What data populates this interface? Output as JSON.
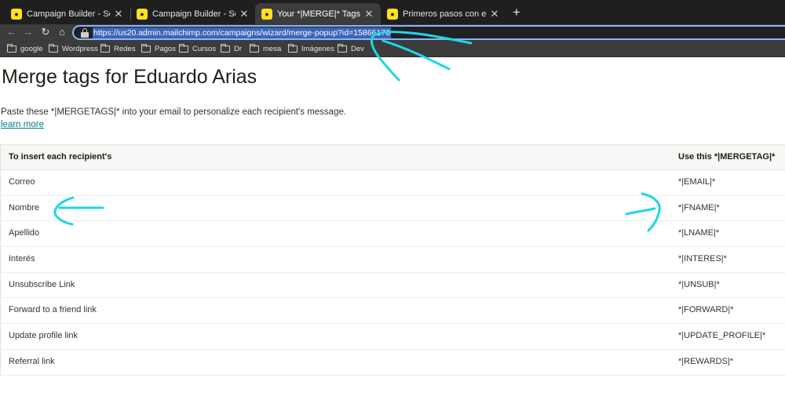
{
  "browser": {
    "tabs": [
      {
        "title": "Campaign Builder - Setup | Mai",
        "active": false
      },
      {
        "title": "Campaign Builder - Setup | Ma",
        "active": false
      },
      {
        "title": "Your *|MERGE|* Tags | Mailchi",
        "active": true
      },
      {
        "title": "Primeros pasos con etiquetas",
        "active": false
      }
    ],
    "url": "https://us20.admin.mailchimp.com/campaigns/wizard/merge-popup?id=15866176",
    "bookmarks": [
      "google",
      "Wordpress",
      "Redes",
      "Pagos",
      "Cursos",
      "Dr",
      "mesa",
      "Imágenes",
      "Dev"
    ]
  },
  "page": {
    "title": "Merge tags for Eduardo Arias",
    "intro": "Paste these *|MERGETAGS|* into your email to personalize each recipient's message.",
    "learn_more": "learn more"
  },
  "table": {
    "col1_header": "To insert each recipient's",
    "col2_header": "Use this *|MERGETAG|*",
    "rows": [
      {
        "field": "Correo",
        "tag": "*|EMAIL|*"
      },
      {
        "field": "Nombre",
        "tag": "*|FNAME|*"
      },
      {
        "field": "Apellido",
        "tag": "*|LNAME|*"
      },
      {
        "field": "Interés",
        "tag": "*|INTERES|*"
      },
      {
        "field": "Unsubscribe Link",
        "tag": "*|UNSUB|*"
      },
      {
        "field": "Forward to a friend link",
        "tag": "*|FORWARD|*"
      },
      {
        "field": "Update profile link",
        "tag": "*|UPDATE_PROFILE|*"
      },
      {
        "field": "Referral link",
        "tag": "*|REWARDS|*"
      }
    ]
  },
  "colors": {
    "annotation": "#1fd6e6",
    "link": "#007c89",
    "url_highlight": "#3a66b8"
  }
}
